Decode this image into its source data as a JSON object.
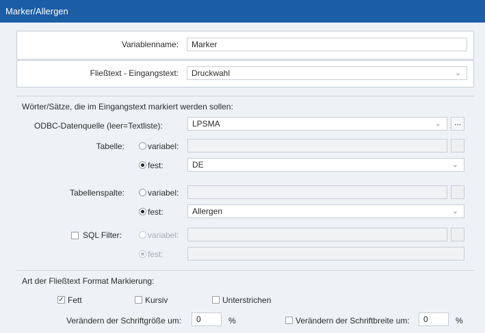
{
  "window": {
    "title": "Marker/Allergen"
  },
  "variable": {
    "label": "Variablenname:",
    "value": "Marker"
  },
  "fliesstext": {
    "label": "Fließtext - Eingangstext:",
    "value": "Druckwahl"
  },
  "section_words": {
    "heading": "Wörter/Sätze, die im Eingangstext markiert werden sollen:"
  },
  "odbc": {
    "label": "ODBC-Datenquelle (leer=Textliste):",
    "value": "LPSMA",
    "browse": "..."
  },
  "tabelle": {
    "label": "Tabelle:",
    "variabel": "variabel:",
    "fest": "fest:",
    "fest_value": "DE"
  },
  "tabellenspalte": {
    "label": "Tabellenspalte:",
    "variabel": "variabel:",
    "fest": "fest:",
    "fest_value": "Allergen"
  },
  "sql": {
    "label": "SQL Filter:",
    "variabel": "variabel:",
    "fest": "fest:"
  },
  "format": {
    "heading": "Art der Fließtext Format Markierung:",
    "fett": "Fett",
    "kursiv": "Kursiv",
    "unterstrichen": "Unterstrichen",
    "schriftgroesse_label": "Verändern der Schriftgröße um:",
    "schriftgroesse_value": "0",
    "percent1": "%",
    "schriftbreite_label": "Verändern der Schriftbreite um:",
    "schriftbreite_value": "0",
    "percent2": "%"
  },
  "icons": {
    "dropdown": "chevron-down-icon",
    "check": "✓"
  }
}
